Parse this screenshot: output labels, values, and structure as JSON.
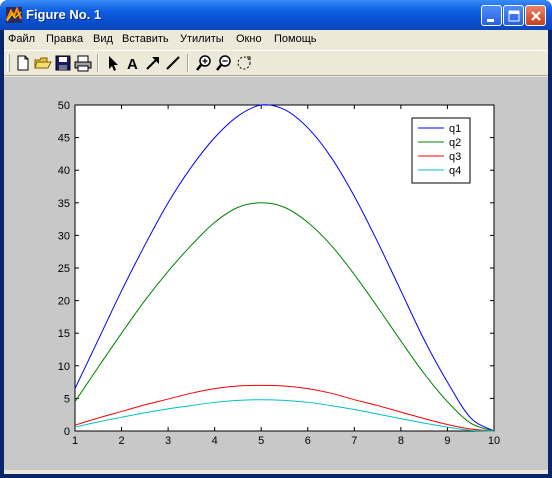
{
  "window": {
    "title": "Figure No. 1",
    "icon": "matlab-figure-icon",
    "buttons": [
      "minimize-icon",
      "maximize-icon",
      "close-icon"
    ]
  },
  "menu": [
    {
      "label": "Файл"
    },
    {
      "label": "Правка"
    },
    {
      "label": "Вид"
    },
    {
      "label": "Вставить"
    },
    {
      "label": "Утилиты"
    },
    {
      "label": "Окно"
    },
    {
      "label": "Помощь"
    }
  ],
  "toolbar": {
    "tools": [
      "new-file-icon",
      "open-folder-icon",
      "save-icon",
      "print-icon",
      "select-arrow-icon",
      "insert-text-icon",
      "insert-arrow-icon",
      "insert-line-icon",
      "zoom-in-icon",
      "zoom-out-icon",
      "rotate-3d-icon"
    ]
  },
  "chart_data": {
    "type": "line",
    "xlim": [
      1,
      10
    ],
    "ylim": [
      0,
      50
    ],
    "xticks": [
      1,
      2,
      3,
      4,
      5,
      6,
      7,
      8,
      9,
      10
    ],
    "yticks": [
      0,
      5,
      10,
      15,
      20,
      25,
      30,
      35,
      40,
      45,
      50
    ],
    "legend_position": "top-right",
    "grid": false,
    "x": [
      1,
      1.5,
      2,
      2.5,
      3,
      3.5,
      4,
      4.5,
      5,
      5.5,
      6,
      6.5,
      7,
      7.5,
      8,
      8.5,
      9,
      9.5,
      10
    ],
    "series": [
      {
        "name": "q1",
        "color": "#0000ff",
        "values": [
          6.5,
          14,
          21.5,
          28.5,
          35,
          40.5,
          45,
          48.3,
          50,
          49.3,
          46.5,
          42,
          36,
          29,
          21.5,
          14,
          7.5,
          2,
          0
        ]
      },
      {
        "name": "q2",
        "color": "#008000",
        "values": [
          4.5,
          9.8,
          15,
          20,
          24.5,
          28.5,
          32,
          34.3,
          35,
          34.3,
          32,
          28.5,
          24,
          19,
          13.8,
          8.8,
          4.5,
          1.2,
          0
        ]
      },
      {
        "name": "q3",
        "color": "#ff0000",
        "values": [
          0.9,
          2,
          3,
          4,
          4.9,
          5.8,
          6.5,
          6.9,
          7,
          6.9,
          6.5,
          5.8,
          4.8,
          3.9,
          2.9,
          1.9,
          1,
          0.3,
          0
        ]
      },
      {
        "name": "q4",
        "color": "#00bfbf",
        "values": [
          0.6,
          1.4,
          2.1,
          2.8,
          3.4,
          3.9,
          4.4,
          4.7,
          4.8,
          4.7,
          4.4,
          3.9,
          3.3,
          2.6,
          1.9,
          1.2,
          0.6,
          0.1,
          0
        ]
      }
    ]
  }
}
